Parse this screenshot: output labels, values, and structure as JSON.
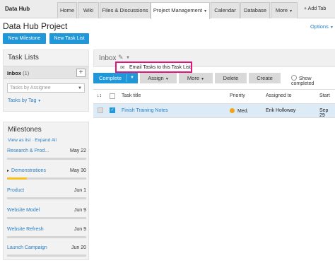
{
  "header": {
    "logo": "Data Hub",
    "tabs": [
      {
        "label": "Home"
      },
      {
        "label": "Wiki"
      },
      {
        "label": "Files & Discussions"
      },
      {
        "label": "Project Management"
      },
      {
        "label": "Calendar"
      },
      {
        "label": "Database"
      },
      {
        "label": "More"
      }
    ],
    "add_tab": "+ Add Tab",
    "dropdown_glyph": "▼"
  },
  "project": {
    "title": "Data Hub Project",
    "options": "Options",
    "new_milestone": "New Milestone",
    "new_task_list": "New Task List"
  },
  "task_lists": {
    "heading": "Task Lists",
    "inbox_label": "Inbox",
    "inbox_count": "(1)",
    "add_glyph": "+",
    "assignee_placeholder": "Tasks by Assignee",
    "tasks_by_tag": "Tasks by Tag"
  },
  "milestones": {
    "heading": "Milestones",
    "view_as_list": "View as list",
    "separator": "·",
    "expand_all": "Expand All",
    "items": [
      {
        "name": "Research & Prod...",
        "date": "May 22",
        "progress": 0
      },
      {
        "name": "Demonstrations",
        "date": "May 30",
        "progress": 0.25,
        "expander": "▸"
      },
      {
        "name": "Product",
        "date": "Jun 1",
        "progress": 0
      },
      {
        "name": "Website Model",
        "date": "Jun 9",
        "progress": 0
      },
      {
        "name": "Website Refresh",
        "date": "Jun 9",
        "progress": 0
      },
      {
        "name": "Launch Campaign",
        "date": "Jun 20",
        "progress": 0
      }
    ]
  },
  "main": {
    "inbox_title": "Inbox",
    "edit_glyph": "✎",
    "popup_text": "Email Tasks to this Task List",
    "toolbar": {
      "complete": "Complete",
      "assign": "Assign",
      "more": "More",
      "delete": "Delete",
      "create": "Create",
      "show_completed": "Show completed"
    },
    "columns": {
      "sort": "↓↕",
      "task_title": "Task title",
      "priority": "Priority",
      "assigned_to": "Assigned to",
      "start": "Start"
    },
    "rows": [
      {
        "title": "Finish Training Notes",
        "priority": "Med.",
        "assigned_to": "Erik Holloway",
        "start": "Sep 29"
      }
    ]
  },
  "colors": {
    "accent": "#1f97d8",
    "link": "#2a7fc4",
    "highlight": "#e0147a",
    "priority_med": "#f0a418"
  }
}
